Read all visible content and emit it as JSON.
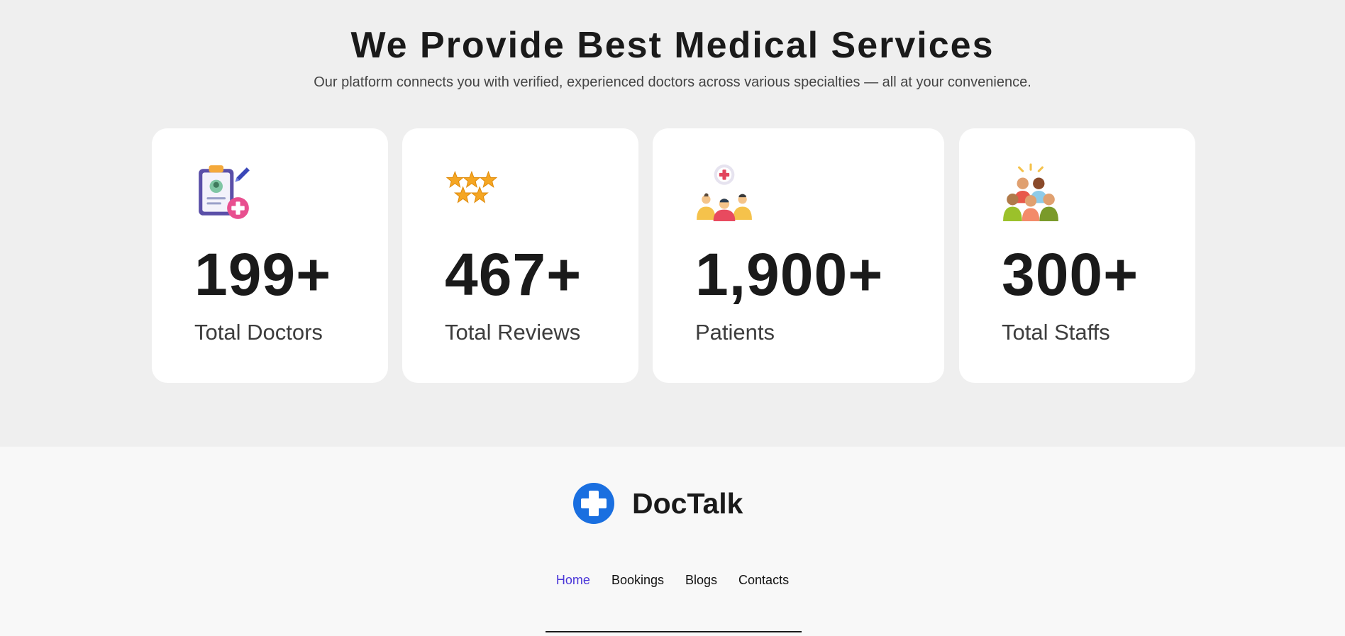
{
  "section": {
    "title": "We Provide Best Medical Services",
    "subtitle": "Our platform connects you with verified, experienced doctors across various specialties — all at your convenience."
  },
  "stats": [
    {
      "icon": "doctor-clipboard-icon",
      "number": "199+",
      "label": "Total Doctors"
    },
    {
      "icon": "star-rating-icon",
      "number": "467+",
      "label": "Total Reviews"
    },
    {
      "icon": "patients-group-icon",
      "number": "1,900+",
      "label": "Patients"
    },
    {
      "icon": "staff-team-icon",
      "number": "300+",
      "label": "Total Staffs"
    }
  ],
  "footer": {
    "brand_name": "DocTalk",
    "nav": [
      "Home",
      "Bookings",
      "Blogs",
      "Contacts"
    ],
    "active_nav": "Home"
  },
  "colors": {
    "accent": "#1a6fe0",
    "nav_active": "#4a36d8",
    "page_bg": "#efefef",
    "footer_bg": "#f8f8f8"
  }
}
